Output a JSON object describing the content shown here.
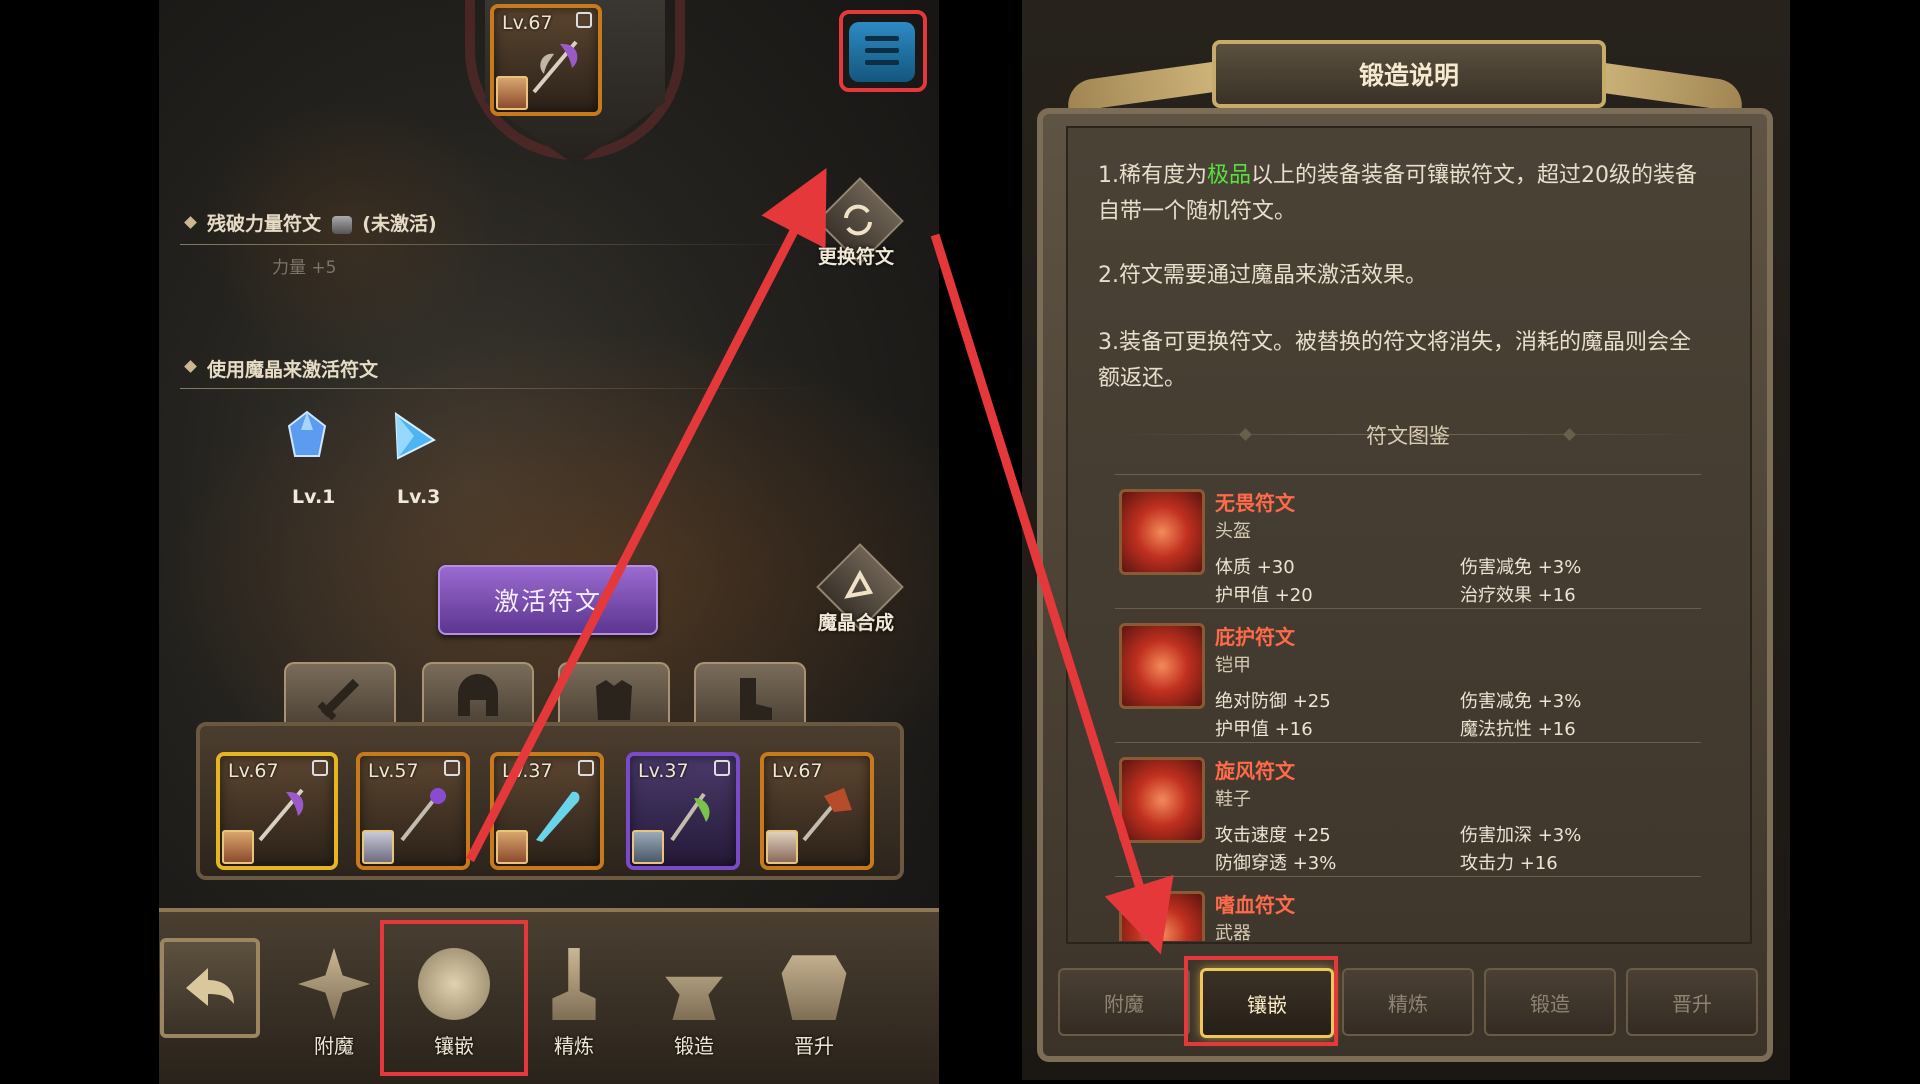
{
  "left_panel": {
    "top_card": {
      "level": "Lv.67"
    },
    "rune_section": {
      "title": "残破力量符文",
      "status": "(未激活)",
      "stat": "力量 +5"
    },
    "change_rune_label": "更换符文",
    "activate_section": {
      "title": "使用魔晶来激活符文"
    },
    "crystals": [
      {
        "label": "Lv.1"
      },
      {
        "label": "Lv.3"
      }
    ],
    "activate_button_label": "激活符文",
    "crystal_synthesis_label": "魔晶合成",
    "slot_tabs": [
      "sword-icon",
      "helmet-icon",
      "armor-icon",
      "boot-icon"
    ],
    "equipment": [
      {
        "level": "Lv.67",
        "border": "#e6b622"
      },
      {
        "level": "Lv.57",
        "border": "#c77a1c"
      },
      {
        "level": "Lv.37",
        "border": "#c77a1c"
      },
      {
        "level": "Lv.37",
        "border": "#7a4bc9"
      },
      {
        "level": "Lv.67",
        "border": "#c77a1c"
      }
    ],
    "bottom_nav": [
      {
        "label": "附魔",
        "icon": "enchant-icon"
      },
      {
        "label": "镶嵌",
        "icon": "inlay-icon"
      },
      {
        "label": "精炼",
        "icon": "refine-icon"
      },
      {
        "label": "锻造",
        "icon": "forge-icon"
      },
      {
        "label": "晋升",
        "icon": "promote-icon"
      }
    ]
  },
  "right_panel": {
    "title": "锻造说明",
    "paragraphs": [
      {
        "prefix": "1.稀有度为",
        "highlight": "极品",
        "suffix": "以上的装备装备可镶嵌符文，超过20级的装备自带一个随机符文。"
      },
      {
        "text": "2.符文需要通过魔晶来激活效果。"
      },
      {
        "text": "3.装备可更换符文。被替换的符文将消失，消耗的魔晶则会全额返还。"
      }
    ],
    "codex_title": "符文图鉴",
    "runes": [
      {
        "name": "无畏符文",
        "slot": "头盔",
        "stats": [
          "体质 +30",
          "伤害减免 +3%",
          "护甲值 +20",
          "治疗效果 +16"
        ]
      },
      {
        "name": "庇护符文",
        "slot": "铠甲",
        "stats": [
          "绝对防御 +25",
          "伤害减免 +3%",
          "护甲值 +16",
          "魔法抗性 +16"
        ]
      },
      {
        "name": "旋风符文",
        "slot": "鞋子",
        "stats": [
          "攻击速度 +25",
          "伤害加深 +3%",
          "防御穿透 +3%",
          "攻击力 +16"
        ]
      },
      {
        "name": "嗜血符文",
        "slot": "武器",
        "stats": []
      }
    ],
    "tabs": [
      {
        "label": "附魔",
        "active": false
      },
      {
        "label": "镶嵌",
        "active": true
      },
      {
        "label": "精炼",
        "active": false
      },
      {
        "label": "锻造",
        "active": false
      },
      {
        "label": "晋升",
        "active": false
      }
    ]
  },
  "colors": {
    "highlight_red": "#e5383b",
    "active_tab_gold": "#f0c85a",
    "rune_name": "#ff6a4a",
    "green_text": "#56e23c"
  }
}
